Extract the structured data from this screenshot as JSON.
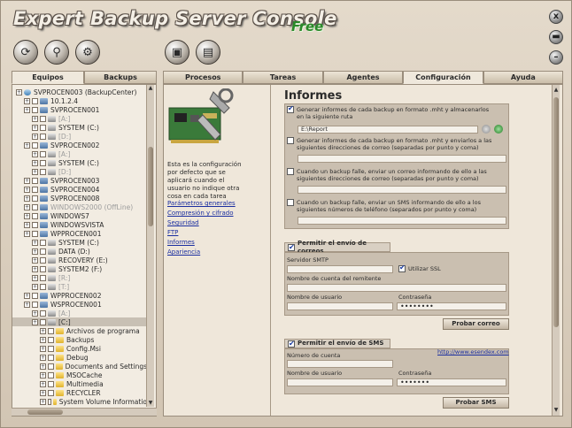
{
  "app": {
    "title": "Expert Backup Server Console",
    "edition": "Free"
  },
  "window_buttons": {
    "close": "x"
  },
  "left_tabs": [
    {
      "label": "Equipos"
    },
    {
      "label": "Backups"
    }
  ],
  "tree": [
    {
      "label": "SVPROCEN003 (BackupCenter)",
      "depth": 0,
      "icon": "net"
    },
    {
      "label": "10.1.2.4",
      "depth": 1,
      "icon": "server"
    },
    {
      "label": "SVPROCEN001",
      "depth": 1,
      "icon": "server"
    },
    {
      "label": "[A:]",
      "depth": 2,
      "icon": "drive",
      "dim": true
    },
    {
      "label": "SYSTEM (C:)",
      "depth": 2,
      "icon": "drive"
    },
    {
      "label": "[D:]",
      "depth": 2,
      "icon": "drive",
      "dim": true
    },
    {
      "label": "SVPROCEN002",
      "depth": 1,
      "icon": "server"
    },
    {
      "label": "[A:]",
      "depth": 2,
      "icon": "drive",
      "dim": true
    },
    {
      "label": "SYSTEM (C:)",
      "depth": 2,
      "icon": "drive"
    },
    {
      "label": "[D:]",
      "depth": 2,
      "icon": "drive",
      "dim": true
    },
    {
      "label": "SVPROCEN003",
      "depth": 1,
      "icon": "server"
    },
    {
      "label": "SVPROCEN004",
      "depth": 1,
      "icon": "server"
    },
    {
      "label": "SVPROCEN008",
      "depth": 1,
      "icon": "server"
    },
    {
      "label": "WINDOWS2000 (OffLine)",
      "depth": 1,
      "icon": "server",
      "dim": true
    },
    {
      "label": "WINDOWS7",
      "depth": 1,
      "icon": "server"
    },
    {
      "label": "WINDOWSVISTA",
      "depth": 1,
      "icon": "server"
    },
    {
      "label": "WPPROCEN001",
      "depth": 1,
      "icon": "server"
    },
    {
      "label": "SYSTEM (C:)",
      "depth": 2,
      "icon": "drive"
    },
    {
      "label": "DATA (D:)",
      "depth": 2,
      "icon": "drive"
    },
    {
      "label": "RECOVERY (E:)",
      "depth": 2,
      "icon": "drive"
    },
    {
      "label": "SYSTEM2 (F:)",
      "depth": 2,
      "icon": "drive"
    },
    {
      "label": "[R:]",
      "depth": 2,
      "icon": "drive",
      "dim": true
    },
    {
      "label": "[T:]",
      "depth": 2,
      "icon": "drive",
      "dim": true
    },
    {
      "label": "WPPROCEN002",
      "depth": 1,
      "icon": "server"
    },
    {
      "label": "WSPROCEN001",
      "depth": 1,
      "icon": "server"
    },
    {
      "label": "[A:]",
      "depth": 2,
      "icon": "drive",
      "dim": true
    },
    {
      "label": "[C:]",
      "depth": 2,
      "icon": "drive",
      "sel": true
    },
    {
      "label": "Archivos de programa",
      "depth": 3,
      "icon": "folder"
    },
    {
      "label": "Backups",
      "depth": 3,
      "icon": "folder"
    },
    {
      "label": "Config.Msi",
      "depth": 3,
      "icon": "folder"
    },
    {
      "label": "Debug",
      "depth": 3,
      "icon": "folder"
    },
    {
      "label": "Documents and Settings",
      "depth": 3,
      "icon": "folder"
    },
    {
      "label": "MSOCache",
      "depth": 3,
      "icon": "folder"
    },
    {
      "label": "Multimedia",
      "depth": 3,
      "icon": "folder"
    },
    {
      "label": "RECYCLER",
      "depth": 3,
      "icon": "folder"
    },
    {
      "label": "System Volume Informatio",
      "depth": 3,
      "icon": "folder"
    }
  ],
  "right_tabs": [
    {
      "label": "Procesos"
    },
    {
      "label": "Tareas"
    },
    {
      "label": "Agentes"
    },
    {
      "label": "Configuración",
      "active": true
    },
    {
      "label": "Ayuda"
    }
  ],
  "info": {
    "text": "Esta es la configuración por defecto que se aplicará cuando el usuario no indique otra cosa en cada tarea",
    "links": [
      "Parámetros generales",
      "Compresión y cifrado",
      "Seguridad",
      "FTP",
      "Informes",
      "Apariencia"
    ]
  },
  "informes": {
    "title": "Informes",
    "opt1": "Generar informes de cada backup en formato .mht y almacenarlos en la siguiente ruta",
    "path": "E:\\Report",
    "opt2": "Generar informes de cada backup en formato .mht y enviarlos a las siguientes direcciones de correo (separadas por punto y coma)",
    "opt3": "Cuando un backup falle, enviar un correo informando de ello a las siguientes direcciones de correo (separadas por punto y coma)",
    "opt4": "Cuando un backup falle, enviar un SMS informando de ello a los siguientes números de teléfono (separados por punto y coma)"
  },
  "correo": {
    "header": "Permitir el envío de correos",
    "smtp_label": "Servidor SMTP",
    "ssl_label": "Utilizar SSL",
    "account_label": "Nombre de cuenta del remitente",
    "user_label": "Nombre de usuario",
    "password_label": "Contraseña",
    "password_value": "••••••••",
    "test_button": "Probar correo"
  },
  "sms": {
    "header": "Permitir el envío de SMS",
    "account_label": "Número de cuenta",
    "link": "http://www.esendex.com",
    "user_label": "Nombre de usuario",
    "password_label": "Contraseña",
    "password_value": "•••••••",
    "test_button": "Probar SMS"
  }
}
